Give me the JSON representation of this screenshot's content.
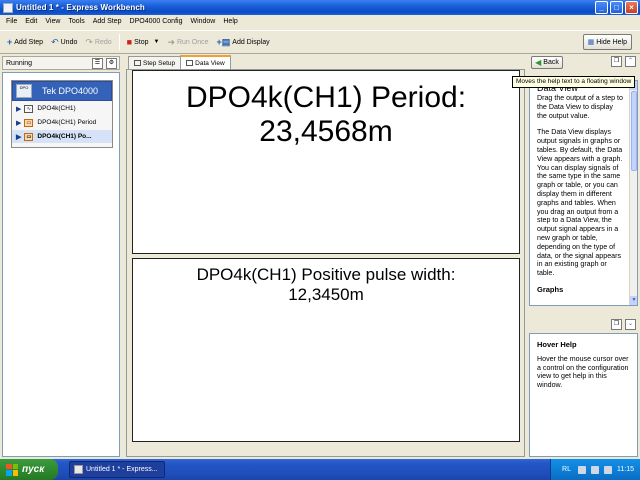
{
  "window": {
    "title": "Untitled 1 * - Express Workbench"
  },
  "menu": [
    "File",
    "Edit",
    "View",
    "Tools",
    "Add Step",
    "DPO4000 Config",
    "Window",
    "Help"
  ],
  "toolbar": {
    "add_step": "Add Step",
    "undo": "Undo",
    "redo": "Redo",
    "stop": "Stop",
    "run_once": "Run Once",
    "add_display": "Add Display",
    "hide_help": "Hide Help"
  },
  "left_panel": {
    "status": "Running",
    "device": {
      "name": "Tek DPO4000",
      "icon_text": "DPO"
    },
    "steps": [
      {
        "label": "DPO4k(CH1)"
      },
      {
        "label": "DPO4k(CH1) Period"
      },
      {
        "label": "DPO4k(CH1) Po..."
      }
    ]
  },
  "tabs": [
    "Step Setup",
    "Data View"
  ],
  "displays": [
    {
      "label": "DPO4k(CH1) Period:",
      "value": "23,4568m"
    },
    {
      "label": "DPO4k(CH1) Positive pulse width:",
      "value": "12,3450m"
    }
  ],
  "help": {
    "back": "Back",
    "tooltip": "Moves the help text to a floating window",
    "title": "Data View",
    "paragraphs": [
      "Drag the output of a step to the Data View to display the output value.",
      "The Data View displays output signals in graphs or tables. By default, the Data View appears with a graph. You can display signals of the same type in the same graph or table, or you can display them in different graphs and tables. When you drag an output from a step to a Data View, the output signal appears in a new graph or table, depending on the type of data, or the signal appears in an existing graph or table."
    ],
    "subheading": "Graphs",
    "hover_title": "Hover Help",
    "hover_text": "Hover the mouse cursor over a control on the configuration view to get help in this window."
  },
  "taskbar": {
    "start": "пуск",
    "task": "Untitled 1 * - Express...",
    "lang": "RL",
    "time": "11:15"
  }
}
